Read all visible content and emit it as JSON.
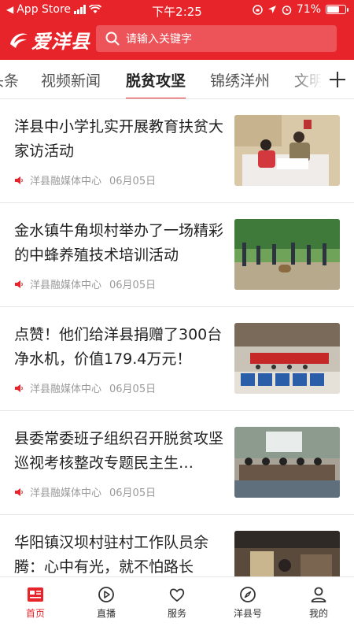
{
  "status_bar": {
    "carrier": "App Store",
    "time": "下午2:25",
    "battery": "71%",
    "battery_level": 0.71,
    "icons": [
      "back-arrow-icon",
      "signal-icon",
      "wifi-icon",
      "orientation-lock-icon",
      "location-icon",
      "alarm-icon",
      "battery-icon"
    ]
  },
  "header": {
    "logo_text": "爱洋县",
    "search_placeholder": "请输入关键字",
    "colors": {
      "brand": "#e8242b"
    }
  },
  "tabs": [
    {
      "label": "头条",
      "active": false
    },
    {
      "label": "视频新闻",
      "active": false
    },
    {
      "label": "脱贫攻坚",
      "active": true
    },
    {
      "label": "锦绣洋州",
      "active": false
    },
    {
      "label": "文明",
      "active": false
    }
  ],
  "news": [
    {
      "title": "洋县中小学扎实开展教育扶贫大家访活动",
      "source": "洋县融媒体中心",
      "date": "06月05日",
      "thumb": "photo-home-visit"
    },
    {
      "title": "金水镇牛角坝村举办了一场精彩的中蜂养殖技术培训活动",
      "source": "洋县融媒体中心",
      "date": "06月05日",
      "thumb": "photo-outdoor-training"
    },
    {
      "title": "点赞！他们给洋县捐赠了300台净水机，价值179.4万元！",
      "source": "洋县融媒体中心",
      "date": "06月05日",
      "thumb": "photo-donation-ceremony"
    },
    {
      "title": "县委常委班子组织召开脱贫攻坚巡视考核整改专题民主生…",
      "source": "洋县融媒体中心",
      "date": "06月05日",
      "thumb": "photo-meeting-room"
    },
    {
      "title": "华阳镇汉坝村驻村工作队员余腾：心中有光，就不怕路长",
      "source": "",
      "date": "",
      "thumb": "photo-village-house"
    }
  ],
  "bottom_nav": [
    {
      "label": "首页",
      "icon": "home-news-icon",
      "active": true
    },
    {
      "label": "直播",
      "icon": "live-play-icon",
      "active": false
    },
    {
      "label": "服务",
      "icon": "heart-hand-icon",
      "active": false
    },
    {
      "label": "洋县号",
      "icon": "compass-icon",
      "active": false
    },
    {
      "label": "我的",
      "icon": "user-icon",
      "active": false
    }
  ]
}
